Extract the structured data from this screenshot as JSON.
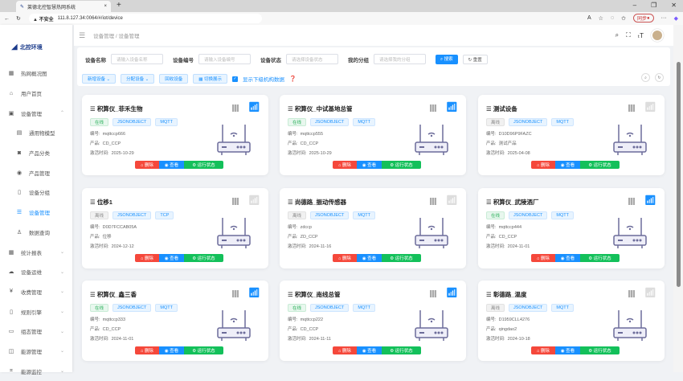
{
  "browser": {
    "tab_title": "莱德北控智慧热网系统",
    "close": "×",
    "new_tab": "+",
    "min": "–",
    "max": "❐",
    "close_win": "✕",
    "insecure": "▲ 不安全",
    "url": "111.8.127.34:0064/#/iot/device",
    "sync": "同步",
    "more": "···"
  },
  "logo": {
    "text": "北控环境"
  },
  "sidebar": {
    "items": [
      {
        "label": "热网概况图",
        "icon": "map-icon",
        "glyph": "▦",
        "sub": false
      },
      {
        "label": "用户首页",
        "icon": "home-icon",
        "glyph": "⌂",
        "sub": false
      },
      {
        "label": "设备管理",
        "icon": "device-icon",
        "glyph": "▣",
        "sub": false,
        "chev": "⌃"
      },
      {
        "label": "通用物模型",
        "icon": "model-icon",
        "glyph": "▤",
        "sub": true
      },
      {
        "label": "产品分类",
        "icon": "category-icon",
        "glyph": "◙",
        "sub": true
      },
      {
        "label": "产品管理",
        "icon": "product-icon",
        "glyph": "◉",
        "sub": true
      },
      {
        "label": "设备分组",
        "icon": "group-icon",
        "glyph": "▯",
        "sub": true
      },
      {
        "label": "设备管理",
        "icon": "list-icon",
        "glyph": "☰",
        "sub": true,
        "active": true
      },
      {
        "label": "数据查询",
        "icon": "query-icon",
        "glyph": "♙",
        "sub": true
      },
      {
        "label": "统计报表",
        "icon": "report-icon",
        "glyph": "▦",
        "sub": false,
        "chev": "⌄"
      },
      {
        "label": "设备运维",
        "icon": "maintenance-icon",
        "glyph": "☁",
        "sub": false,
        "chev": "⌄"
      },
      {
        "label": "收费管理",
        "icon": "yen-icon",
        "glyph": "¥",
        "sub": false,
        "chev": "⌄"
      },
      {
        "label": "规则引擎",
        "icon": "rule-icon",
        "glyph": "▯",
        "sub": false,
        "chev": "⌄"
      },
      {
        "label": "组态管理",
        "icon": "config-icon",
        "glyph": "▭",
        "sub": false,
        "chev": "⌄"
      },
      {
        "label": "能源管理",
        "icon": "energy-icon",
        "glyph": "◫",
        "sub": false,
        "chev": "⌄"
      },
      {
        "label": "能源监控",
        "icon": "monitor-icon",
        "glyph": "⌗",
        "sub": false,
        "chev": "⌄"
      }
    ]
  },
  "header": {
    "breadcrumb1": "设备管理",
    "sep": "/",
    "breadcrumb2": "设备管理"
  },
  "search": {
    "name_label": "设备名称",
    "name_ph": "请输入设备名称",
    "code_label": "设备编号",
    "code_ph": "请输入设备编号",
    "status_label": "设备状态",
    "status_ph": "请选择设备状态",
    "group_label": "我的分组",
    "group_ph": "请选择我的分组",
    "search_btn": "⌕ 搜索",
    "reset_btn": "↻ 重置",
    "add_btn": "新增设备 ⌄",
    "assign_btn": "分配设备 ⌄",
    "recycle_btn": "回收设备",
    "switch_btn": "▦ 切换展示",
    "show_sub": "显示下级机构数据",
    "check": "✓"
  },
  "card_labels": {
    "code": "编号:",
    "product": "产品:",
    "activated": "激活时间:",
    "delete": "⌂ 删除",
    "view": "◉ 查看",
    "run": "⚙ 运行状态"
  },
  "devices": [
    {
      "name": "积算仪_菲禾生物",
      "status": "在线",
      "online": true,
      "format": "JSONOBJECT",
      "protocol": "MQTT",
      "code": "mqttccp666",
      "product": "CD_CCP",
      "time": "2025-10-29"
    },
    {
      "name": "积算仪_中试基地总管",
      "status": "在线",
      "online": true,
      "format": "JSONOBJECT",
      "protocol": "MQTT",
      "code": "mqttccp555",
      "product": "CD_CCP",
      "time": "2025-10-29"
    },
    {
      "name": "测试设备",
      "status": "离线",
      "online": false,
      "format": "JSONOBJECT",
      "protocol": "MQTT",
      "code": "D10D96P9FAZC",
      "product": "测试产品",
      "time": "2025-04-08"
    },
    {
      "name": "位移1",
      "status": "离线",
      "online": false,
      "format": "JSONOBJECT",
      "protocol": "TCP",
      "code": "D0D7FCCAB05A",
      "product": "位移",
      "time": "2024-12-12"
    },
    {
      "name": "尚德路_振动传感器",
      "status": "离线",
      "online": false,
      "format": "JSONOBJECT",
      "protocol": "MQTT",
      "code": "zdccp",
      "product": "ZD_CCP",
      "time": "2024-11-16"
    },
    {
      "name": "积算仪_武陵酒厂",
      "status": "在线",
      "online": true,
      "format": "JSONOBJECT",
      "protocol": "MQTT",
      "code": "mqttccp444",
      "product": "CD_CCP",
      "time": "2024-11-01"
    },
    {
      "name": "积算仪_鑫三香",
      "status": "在线",
      "online": true,
      "format": "JSONOBJECT",
      "protocol": "MQTT",
      "code": "mqttccp333",
      "product": "CD_CCP",
      "time": "2024-11-01"
    },
    {
      "name": "积算仪_南线总管",
      "status": "在线",
      "online": true,
      "format": "JSONOBJECT",
      "protocol": "MQTT",
      "code": "mqttccp222",
      "product": "CD_CCP",
      "time": "2024-11-11"
    },
    {
      "name": "彰德路_温度",
      "status": "离线",
      "online": false,
      "format": "JSONOBJECT",
      "protocol": "MQTT",
      "code": "D1959CLL4276",
      "product": "qingdao2",
      "time": "2024-10-18"
    }
  ],
  "colors": {
    "primary": "#1890ff",
    "danger": "#f5483b",
    "success": "#13c05a"
  }
}
